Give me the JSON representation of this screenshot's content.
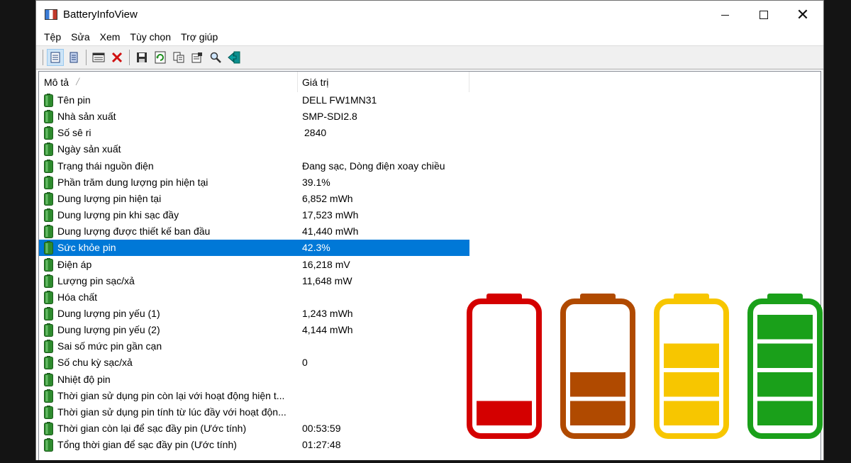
{
  "window": {
    "title": "BatteryInfoView"
  },
  "menu": [
    "Tệp",
    "Sửa",
    "Xem",
    "Tùy chọn",
    "Trợ giúp"
  ],
  "toolbar": {
    "buttons": [
      {
        "name": "html-report-icon"
      },
      {
        "name": "copy-report-icon"
      },
      {
        "name": "properties-window-icon"
      },
      {
        "name": "delete-icon"
      },
      {
        "name": "save-icon"
      },
      {
        "name": "refresh-icon"
      },
      {
        "name": "copy-icon"
      },
      {
        "name": "properties-icon"
      },
      {
        "name": "find-icon"
      },
      {
        "name": "exit-icon"
      }
    ]
  },
  "columns": {
    "description": "Mô tả",
    "value": "Giá trị"
  },
  "rows": [
    {
      "label": "Tên pin",
      "value": "DELL FW1MN31"
    },
    {
      "label": "Nhà sản xuất",
      "value": "SMP-SDI2.8"
    },
    {
      "label": "Số sê ri",
      "value": "2840"
    },
    {
      "label": "Ngày sản xuất",
      "value": ""
    },
    {
      "label": "Trạng thái nguồn điện",
      "value": "Đang sạc, Dòng điện xoay chiều"
    },
    {
      "label": "Phần trăm dung lượng pin hiện tại",
      "value": "39.1%"
    },
    {
      "label": "Dung lượng pin hiện tại",
      "value": "6,852 mWh"
    },
    {
      "label": "Dung lượng pin khi sạc đầy",
      "value": "17,523 mWh"
    },
    {
      "label": "Dung lượng được thiết kế ban đầu",
      "value": "41,440 mWh"
    },
    {
      "label": "Sức khỏe pin",
      "value": "42.3%",
      "selected": true
    },
    {
      "label": "Điện áp",
      "value": "16,218 mV"
    },
    {
      "label": "Lượng pin sạc/xả",
      "value": "11,648 mW"
    },
    {
      "label": "Hóa chất",
      "value": ""
    },
    {
      "label": "Dung lượng pin yếu (1)",
      "value": "1,243 mWh"
    },
    {
      "label": "Dung lượng pin yếu (2)",
      "value": "4,144 mWh"
    },
    {
      "label": "Sai số mức pin gần cạn",
      "value": ""
    },
    {
      "label": "Số chu kỳ sạc/xả",
      "value": "0"
    },
    {
      "label": "Nhiệt độ pin",
      "value": ""
    },
    {
      "label": "Thời gian sử dụng pin còn lại với hoạt động hiện t...",
      "value": ""
    },
    {
      "label": "Thời gian sử dụng pin tính từ lúc đầy với hoạt độn...",
      "value": ""
    },
    {
      "label": "Thời gian còn lại để sạc đầy pin (Ước tính)",
      "value": "00:53:59"
    },
    {
      "label": "Tổng thời gian để sạc đầy pin (Ước tính)",
      "value": "01:27:48"
    }
  ],
  "battery_graphic": {
    "batteries": [
      {
        "color": "#d40000",
        "filled_bars": 1,
        "total_bars": 4
      },
      {
        "color": "#b04a00",
        "filled_bars": 2,
        "total_bars": 4
      },
      {
        "color": "#f7c600",
        "filled_bars": 3,
        "total_bars": 4
      },
      {
        "color": "#1aa01a",
        "filled_bars": 4,
        "total_bars": 4
      }
    ]
  },
  "colors": {
    "selection": "#0078d7",
    "row_icon": "#2e8b2e"
  }
}
